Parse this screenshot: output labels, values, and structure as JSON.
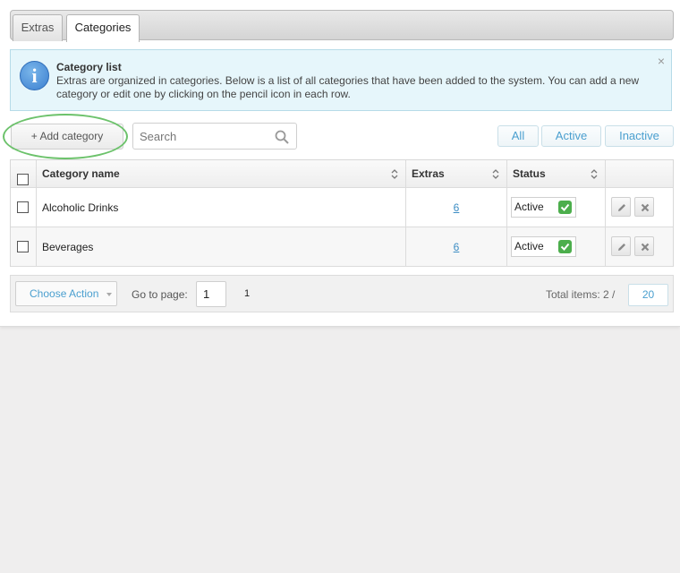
{
  "tabs": [
    {
      "label": "Extras",
      "active": false
    },
    {
      "label": "Categories",
      "active": true
    }
  ],
  "info": {
    "title": "Category list",
    "text": "Extras are organized in categories. Below is a list of all categories that have been added to the system. You can add a new category or edit one by clicking on the pencil icon in each row.",
    "close": "×"
  },
  "toolbar": {
    "add_label": "+ Add category",
    "search_placeholder": "Search",
    "filters": [
      "All",
      "Active",
      "Inactive"
    ]
  },
  "table": {
    "headers": [
      "Category name",
      "Extras",
      "Status"
    ],
    "rows": [
      {
        "name": "Alcoholic Drinks",
        "extras": "6",
        "status": "Active"
      },
      {
        "name": "Beverages",
        "extras": "6",
        "status": "Active"
      }
    ]
  },
  "footer": {
    "choose_action": "Choose Action",
    "goto_label": "Go to page:",
    "goto_value": "1",
    "page": "1",
    "total_label": "Total items: 2 /",
    "per_page": "20"
  },
  "colors": {
    "accent": "#4a9fcf",
    "highlight_ellipse": "#6cc26b",
    "status_ok": "#4cae4c",
    "info_bg": "#e6f6fb"
  }
}
